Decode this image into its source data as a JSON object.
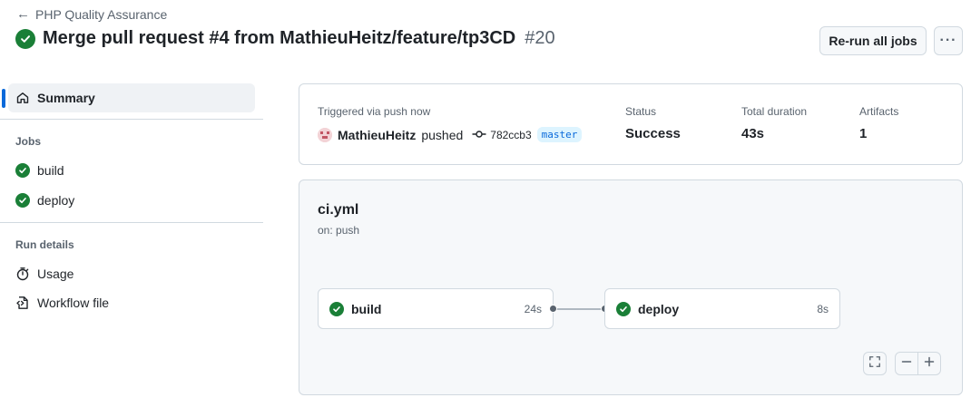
{
  "header": {
    "back_label": "PHP Quality Assurance",
    "title": "Merge pull request #4 from MathieuHeitz/feature/tp3CD",
    "run_number": "#20",
    "rerun_label": "Re-run all jobs",
    "more_label": "···"
  },
  "sidebar": {
    "summary_label": "Summary",
    "jobs_heading": "Jobs",
    "jobs": [
      {
        "label": "build",
        "status": "success"
      },
      {
        "label": "deploy",
        "status": "success"
      }
    ],
    "run_details_heading": "Run details",
    "details": [
      {
        "label": "Usage",
        "icon": "stopwatch-icon"
      },
      {
        "label": "Workflow file",
        "icon": "file-code-icon"
      }
    ]
  },
  "summary": {
    "trigger_label": "Triggered via push now",
    "actor": "MathieuHeitz",
    "action": "pushed",
    "commit": "782ccb3",
    "branch": "master",
    "status_label": "Status",
    "status_value": "Success",
    "duration_label": "Total duration",
    "duration_value": "43s",
    "artifacts_label": "Artifacts",
    "artifacts_value": "1"
  },
  "workflow": {
    "file": "ci.yml",
    "trigger": "on: push",
    "jobs": [
      {
        "name": "build",
        "duration": "24s",
        "status": "success"
      },
      {
        "name": "deploy",
        "duration": "8s",
        "status": "success"
      }
    ]
  },
  "colors": {
    "success": "#1a7f37",
    "accent": "#0969da",
    "muted": "#59636e"
  }
}
